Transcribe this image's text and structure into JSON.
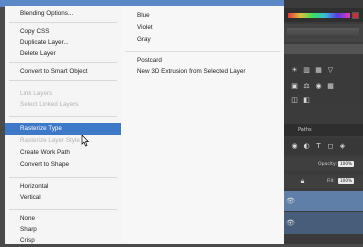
{
  "context_menu": {
    "items": [
      {
        "label": "Blending Options...",
        "state": "normal"
      },
      {
        "label": "Copy CSS",
        "state": "normal"
      },
      {
        "label": "Duplicate Layer...",
        "state": "normal"
      },
      {
        "label": "Delete Layer",
        "state": "normal"
      },
      {
        "label": "Convert to Smart Object",
        "state": "normal"
      },
      {
        "label": "Link Layers",
        "state": "disabled"
      },
      {
        "label": "Select Linked Layers",
        "state": "disabled"
      },
      {
        "label": "Rasterize Type",
        "state": "selected"
      },
      {
        "label": "Rasterize Layer Style",
        "state": "disabled"
      },
      {
        "label": "Create Work Path",
        "state": "normal"
      },
      {
        "label": "Convert to Shape",
        "state": "normal"
      },
      {
        "label": "Horizontal",
        "state": "normal"
      },
      {
        "label": "Vertical",
        "state": "normal"
      },
      {
        "label": "None",
        "state": "normal"
      },
      {
        "label": "Sharp",
        "state": "normal"
      },
      {
        "label": "Crisp",
        "state": "normal"
      }
    ]
  },
  "color_menu": {
    "items": [
      {
        "label": "Blue"
      },
      {
        "label": "Violet"
      },
      {
        "label": "Gray"
      },
      {
        "label": "Postcard"
      },
      {
        "label": "New 3D Extrusion from Selected Layer"
      }
    ]
  },
  "panels": {
    "tab_paths": "Paths",
    "opacity_label": "Opacity:",
    "opacity_value": "100%",
    "fill_label": "Fill:",
    "fill_value": "100%"
  },
  "colors": {
    "selection": "#3e79c8",
    "menu_bg": "#f5f5f5",
    "panel_bg": "#3b3b3b"
  }
}
